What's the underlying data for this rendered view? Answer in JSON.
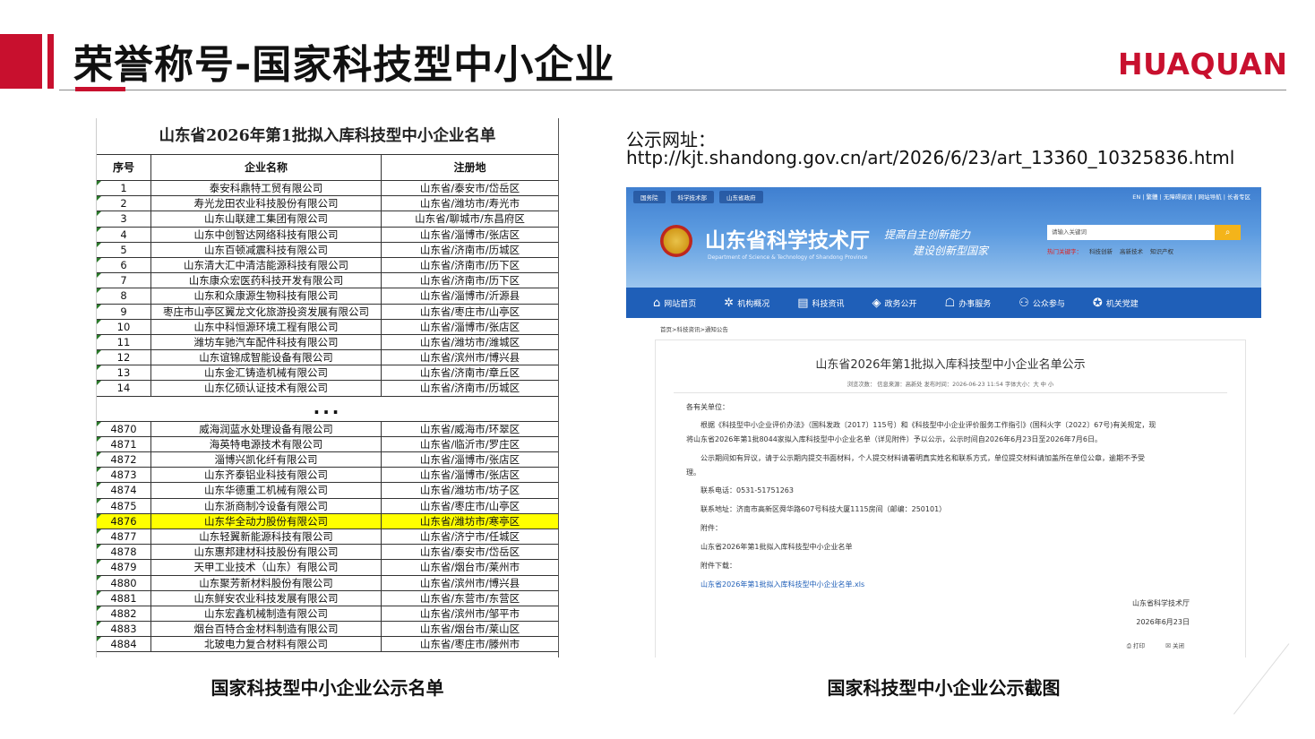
{
  "slide": {
    "title": "荣誉称号-国家科技型中小企业",
    "logo_text": "HUAQUAN",
    "caption_left": "国家科技型中小企业公示名单",
    "caption_right": "国家科技型中小企业公示截图",
    "colors": {
      "accent": "#c8102e",
      "highlight": "#ffff00",
      "nav_blue": "#1f5fb8"
    }
  },
  "table": {
    "title": "山东省2026年第1批拟入库科技型中小企业名单",
    "headers": [
      "序号",
      "企业名称",
      "注册地"
    ],
    "rows_top": [
      [
        "1",
        "泰安科鼎特工贸有限公司",
        "山东省/泰安市/岱岳区"
      ],
      [
        "2",
        "寿光龙田农业科技股份有限公司",
        "山东省/潍坊市/寿光市"
      ],
      [
        "3",
        "山东山联建工集团有限公司",
        "山东省/聊城市/东昌府区"
      ],
      [
        "4",
        "山东中创智达网络科技有限公司",
        "山东省/淄博市/张店区"
      ],
      [
        "5",
        "山东百顿减震科技有限公司",
        "山东省/济南市/历城区"
      ],
      [
        "6",
        "山东清大汇中清洁能源科技有限公司",
        "山东省/济南市/历下区"
      ],
      [
        "7",
        "山东康众宏医药科技开发有限公司",
        "山东省/济南市/历下区"
      ],
      [
        "8",
        "山东和众康源生物科技有限公司",
        "山东省/淄博市/沂源县"
      ],
      [
        "9",
        "枣庄市山亭区翼龙文化旅游投资发展有限公司",
        "山东省/枣庄市/山亭区"
      ],
      [
        "10",
        "山东中科恒源环境工程有限公司",
        "山东省/淄博市/张店区"
      ],
      [
        "11",
        "潍坊车驰汽车配件科技有限公司",
        "山东省/潍坊市/潍城区"
      ],
      [
        "12",
        "山东谊锦成智能设备有限公司",
        "山东省/滨州市/博兴县"
      ],
      [
        "13",
        "山东金汇铸造机械有限公司",
        "山东省/济南市/章丘区"
      ],
      [
        "14",
        "山东亿硕认证技术有限公司",
        "山东省/济南市/历城区"
      ]
    ],
    "ellipsis": "...",
    "rows_bottom": [
      [
        "4870",
        "威海润蓝水处理设备有限公司",
        "山东省/威海市/环翠区"
      ],
      [
        "4871",
        "海英特电源技术有限公司",
        "山东省/临沂市/罗庄区"
      ],
      [
        "4872",
        "淄博兴凯化纤有限公司",
        "山东省/淄博市/张店区"
      ],
      [
        "4873",
        "山东齐泰铝业科技有限公司",
        "山东省/淄博市/张店区"
      ],
      [
        "4874",
        "山东华德重工机械有限公司",
        "山东省/潍坊市/坊子区"
      ],
      [
        "4875",
        "山东浙商制冷设备有限公司",
        "山东省/枣庄市/山亭区"
      ],
      [
        "4876",
        "山东华全动力股份有限公司",
        "山东省/潍坊市/寒亭区"
      ],
      [
        "4877",
        "山东轻翼新能源科技有限公司",
        "山东省/济宁市/任城区"
      ],
      [
        "4878",
        "山东惠邦建材科技股份有限公司",
        "山东省/泰安市/岱岳区"
      ],
      [
        "4879",
        "天甲工业技术（山东）有限公司",
        "山东省/烟台市/莱州市"
      ],
      [
        "4880",
        "山东聚芳新材料股份有限公司",
        "山东省/滨州市/博兴县"
      ],
      [
        "4881",
        "山东鲜安农业科技发展有限公司",
        "山东省/东营市/东营区"
      ],
      [
        "4882",
        "山东宏鑫机械制造有限公司",
        "山东省/滨州市/邹平市"
      ],
      [
        "4883",
        "烟台百特合金材料制造有限公司",
        "山东省/烟台市/莱山区"
      ],
      [
        "4884",
        "北玻电力复合材料有限公司",
        "山东省/枣庄市/滕州市"
      ]
    ],
    "highlight_index": 6
  },
  "notice": {
    "url_label": "公示网址：",
    "url": "http://kjt.shandong.gov.cn/art/2026/6/23/art_13360_10325836.html"
  },
  "screenshot": {
    "top_links": [
      "国务院",
      "科学技术部",
      "山东省政府"
    ],
    "utility_links": "EN | 繁體 | 无障碍阅读 | 网站导航 | 长者专区",
    "site_name": "山东省科学技术厅",
    "site_name_en": "Department of Science & Technology of Shandong Province",
    "slogan_line1": "提高自主创新能力",
    "slogan_line2": "建设创新型国家",
    "search_placeholder": "请输入关键词",
    "hot_label": "热门关键字：",
    "hot_keywords": [
      "科技创新",
      "高新技术",
      "知识产权"
    ],
    "nav": [
      {
        "icon": "home-icon",
        "glyph": "⌂",
        "label": "网站首页"
      },
      {
        "icon": "org-icon",
        "glyph": "✲",
        "label": "机构概况"
      },
      {
        "icon": "news-icon",
        "glyph": "▤",
        "label": "科技资讯"
      },
      {
        "icon": "layers-icon",
        "glyph": "◈",
        "label": "政务公开"
      },
      {
        "icon": "service-icon",
        "glyph": "☖",
        "label": "办事服务"
      },
      {
        "icon": "people-icon",
        "glyph": "⚇",
        "label": "公众参与"
      },
      {
        "icon": "party-icon",
        "glyph": "✪",
        "label": "机关党建"
      }
    ],
    "breadcrumb": "首页>科技资讯>通知公告",
    "doc_title": "山东省2026年第1批拟入库科技型中小企业名单公示",
    "doc_meta": "浏览次数：        信息来源：高新处        发布时间：2026-06-23 11:54        字体大小：大 中 小",
    "salutation": "各有关单位：",
    "para1_line1": "根据《科技型中小企业评价办法》（国科发政〔2017〕115号）和《科技型中小企业评价服务工作指引》(国科火字〔2022〕67号)有关规定，现",
    "para1_line2": "将山东省2026年第1批8044家拟入库科技型中小企业名单（详见附件）予以公示，公示时间自2026年6月23日至2026年7月6日。",
    "para2_line1": "公示期间如有异议，请于公示期内提交书面材料，个人提交材料请署明真实姓名和联系方式，单位提交材料请加盖所在单位公章，逾期不予受",
    "para2_line2": "理。",
    "phone": "联系电话：0531-51751263",
    "address": "联系地址：济南市高新区舜华路607号科技大厦1115房间（邮编：250101）",
    "attach_label": "附件：",
    "attach_name": "山东省2026年第1批拟入库科技型中小企业名单",
    "download_label": "附件下载：",
    "download_link": "山东省2026年第1批拟入库科技型中小企业名单.xls",
    "sign_org": "山东省科学技术厅",
    "sign_date": "2026年6月23日",
    "print_label": "打印",
    "close_label": "关闭"
  }
}
